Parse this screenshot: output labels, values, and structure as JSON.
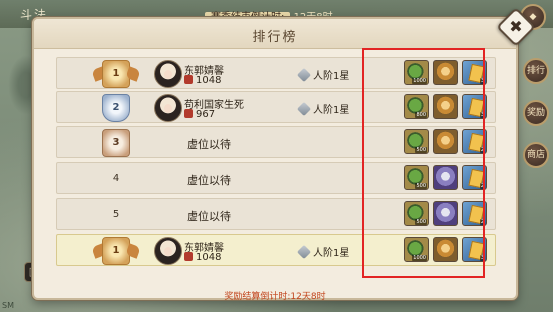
{
  "background": {
    "title": "斗法",
    "season_label": "赛季结束倒计时:",
    "season_time": "12天8时",
    "side_buttons": [
      "排行",
      "奖励",
      "商店"
    ],
    "corner_text": "SM"
  },
  "panel": {
    "title": "排行榜",
    "close_symbol": "✖"
  },
  "rows": [
    {
      "rank": "1",
      "name": "东郭婧馨",
      "score": "1048",
      "tier": "人阶1星",
      "rewards": [
        "1000",
        "",
        "3"
      ]
    },
    {
      "rank": "2",
      "name": "苟利国家生死",
      "score": "967",
      "tier": "人阶1星",
      "rewards": [
        "800",
        "",
        "3"
      ]
    },
    {
      "rank": "3",
      "vacant": "虚位以待",
      "rewards": [
        "500",
        "",
        "2"
      ]
    },
    {
      "rank": "4",
      "vacant": "虚位以待",
      "rewards": [
        "500",
        "",
        "2"
      ]
    },
    {
      "rank": "5",
      "vacant": "虚位以待",
      "rewards": [
        "500",
        "",
        "2"
      ]
    },
    {
      "rank": "1",
      "name": "东郭婧馨",
      "score": "1048",
      "tier": "人阶1星",
      "rewards": [
        "1000",
        "",
        "3"
      ]
    }
  ],
  "footer": {
    "label": "奖励结算倒计时:",
    "time": "12天8时"
  },
  "colors": {
    "highlight_frame": "#e22424",
    "footer_text": "#c2461e"
  }
}
